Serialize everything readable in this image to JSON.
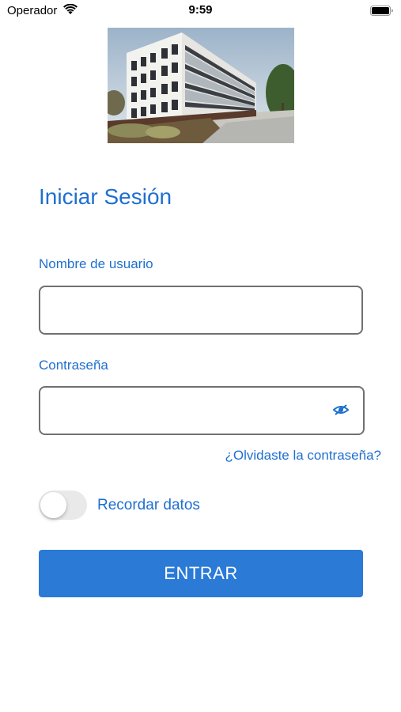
{
  "status_bar": {
    "carrier": "Operador",
    "time": "9:59",
    "wifi_icon": "wifi-icon",
    "battery_icon": "battery-icon"
  },
  "hero_image": "building-photo",
  "login": {
    "title": "Iniciar Sesión",
    "username_label": "Nombre de usuario",
    "username_value": "",
    "password_label": "Contraseña",
    "password_value": "",
    "password_toggle_icon": "eye-icon",
    "forgot_link": "¿Olvidaste la contraseña?",
    "remember_label": "Recordar datos",
    "remember_on": false,
    "submit_label": "ENTRAR"
  },
  "colors": {
    "accent": "#1e6fd0",
    "button": "#2a7ad6",
    "input_border": "#707070",
    "toggle_off": "#e9e9ea"
  }
}
